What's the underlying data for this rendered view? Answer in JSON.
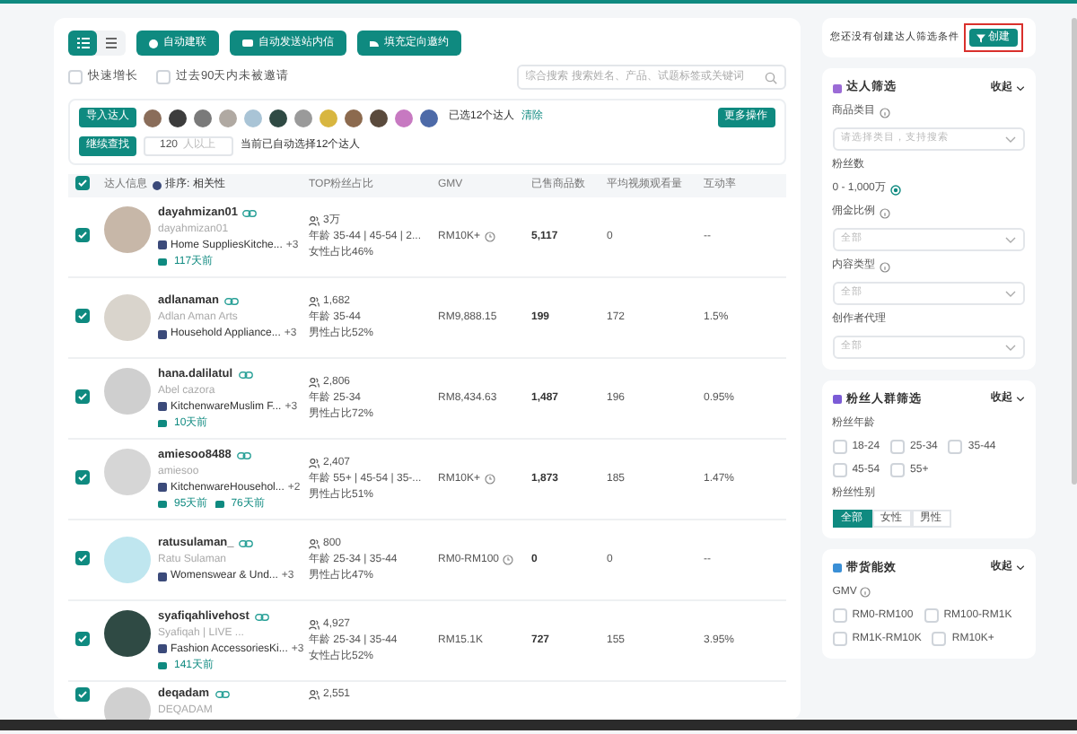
{
  "toolbar": {
    "views": [
      {
        "kind": "list",
        "selected": true
      },
      {
        "kind": "grid",
        "selected": false
      }
    ],
    "buttons": [
      {
        "kind": "link",
        "label": "自动建联"
      },
      {
        "kind": "mail",
        "label": "自动发送站内信"
      },
      {
        "kind": "invite",
        "label": "填充定向邀约"
      }
    ]
  },
  "filters": [
    {
      "label": "快速增长",
      "checked": false
    },
    {
      "label": "过去90天内未被邀请",
      "checked": false
    }
  ],
  "search": {
    "placeholder": "综合搜索 搜索姓名、产品、试题标签或关键词"
  },
  "import_bar": {
    "button": "导入达人",
    "selected_text": "已选12个达人",
    "clear": "清除",
    "more": "更多操作",
    "continue": "继续查找",
    "min_value": "120",
    "min_suffix": "人以上",
    "auto_text": "当前已自动选择12个达人"
  },
  "table": {
    "header_checked": true,
    "columns": [
      "达人信息",
      "排序: 相关性",
      "TOP粉丝占比",
      "GMV",
      "已售商品数",
      "平均视频观看量",
      "互动率"
    ],
    "rows": [
      {
        "checked": true,
        "name": "dayahmizan01",
        "handle": "dayahmizan01",
        "category": "Home SuppliesKitche...",
        "extra": "+3",
        "tags": [
          {
            "kind": "shop",
            "text": "117天前"
          }
        ],
        "fans": "3万",
        "age": "年龄 35-44 | 45-54 | 2...",
        "gender": "女性占比46%",
        "gmv": "RM10K+",
        "gmv_note": true,
        "sold": "5,117",
        "views": "0",
        "rate": "--"
      },
      {
        "checked": true,
        "name": "adlanaman",
        "handle": "Adlan Aman Arts",
        "category": "Household Appliance...",
        "extra": "+3",
        "tags": [],
        "fans": "1,682",
        "age": "年龄 35-44",
        "gender": "男性占比52%",
        "gmv": "RM9,888.15",
        "gmv_note": false,
        "sold": "199",
        "views": "172",
        "rate": "1.5%"
      },
      {
        "checked": true,
        "name": "hana.dalilatul",
        "handle": "Abel cazora",
        "category": "KitchenwareMuslim F...",
        "extra": "+3",
        "tags": [
          {
            "kind": "chat",
            "text": "10天前"
          }
        ],
        "fans": "2,806",
        "age": "年龄 25-34",
        "gender": "男性占比72%",
        "gmv": "RM8,434.63",
        "gmv_note": false,
        "sold": "1,487",
        "views": "196",
        "rate": "0.95%"
      },
      {
        "checked": true,
        "name": "amiesoo8488",
        "handle": "amiesoo",
        "category": "KitchenwareHousehol...",
        "extra": "+2",
        "tags": [
          {
            "kind": "shop",
            "text": "95天前"
          },
          {
            "kind": "chat",
            "text": "76天前"
          }
        ],
        "fans": "2,407",
        "age": "年龄 55+ | 45-54 | 35-...",
        "gender": "男性占比51%",
        "gmv": "RM10K+",
        "gmv_note": true,
        "sold": "1,873",
        "views": "185",
        "rate": "1.47%"
      },
      {
        "checked": true,
        "name": "ratusulaman_",
        "handle": "Ratu Sulaman",
        "category": "Womenswear & Und...",
        "extra": "+3",
        "tags": [],
        "fans": "800",
        "age": "年龄 25-34 | 35-44",
        "gender": "男性占比47%",
        "gmv": "RM0-RM100",
        "gmv_note": true,
        "sold": "0",
        "views": "0",
        "rate": "--"
      },
      {
        "checked": true,
        "name": "syafiqahlivehost",
        "handle": "Syafiqah | LIVE ...",
        "category": "Fashion AccessoriesKi...",
        "extra": "+3",
        "tags": [
          {
            "kind": "shop",
            "text": "141天前"
          }
        ],
        "fans": "4,927",
        "age": "年龄 25-34 | 35-44",
        "gender": "女性占比52%",
        "gmv": "RM15.1K",
        "gmv_note": false,
        "sold": "727",
        "views": "155",
        "rate": "3.95%"
      },
      {
        "checked": true,
        "name": "deqadam",
        "handle": "DEQADAM",
        "fans": "2,551"
      }
    ]
  },
  "side": {
    "notice": "您还没有创建达人筛选条件",
    "create": "创建",
    "creator_filter": {
      "title": "达人筛选",
      "collapse": "收起",
      "category_label": "商品类目",
      "category_placeholder": "请选择类目，支持搜索",
      "fans_label": "粉丝数",
      "fans_range": "0 - 1,000万",
      "selects": [
        {
          "label": "佣金比例",
          "info": true,
          "value": "全部"
        },
        {
          "label": "内容类型",
          "info": true,
          "value": "全部"
        },
        {
          "label": "创作者代理",
          "info": false,
          "value": "全部"
        }
      ]
    },
    "audience_filter": {
      "title": "粉丝人群筛选",
      "collapse": "收起",
      "age_label": "粉丝年龄",
      "ages": [
        {
          "label": "18-24",
          "checked": false
        },
        {
          "label": "25-34",
          "checked": false
        },
        {
          "label": "35-44",
          "checked": false
        },
        {
          "label": "45-54",
          "checked": false
        },
        {
          "label": "55+",
          "checked": false
        }
      ],
      "gender_label": "粉丝性别",
      "genders": [
        {
          "label": "全部",
          "selected": true
        },
        {
          "label": "女性",
          "selected": false
        },
        {
          "label": "男性",
          "selected": false
        }
      ]
    },
    "sales_filter": {
      "title": "带货能效",
      "collapse": "收起",
      "gmv_label": "GMV",
      "gmv_options": [
        {
          "label": "RM0-RM100",
          "checked": false
        },
        {
          "label": "RM100-RM1K",
          "checked": false
        },
        {
          "label": "RM1K-RM10K",
          "checked": false
        },
        {
          "label": "RM10K+",
          "checked": false
        }
      ]
    }
  }
}
